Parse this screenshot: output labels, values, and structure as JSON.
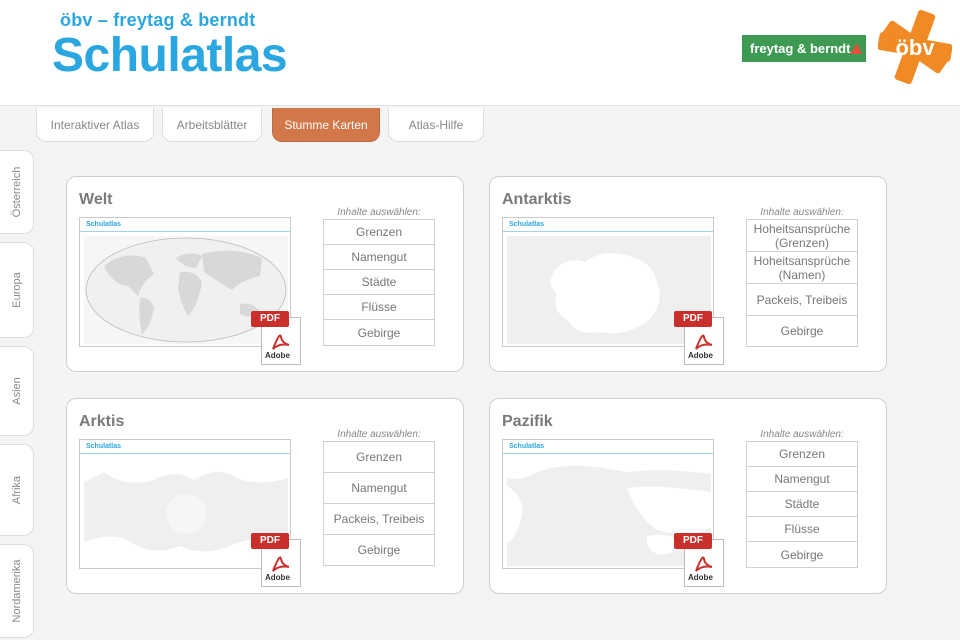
{
  "header": {
    "subtitle": "öbv – freytag & berndt",
    "title": "Schulatlas",
    "partner_logo_text": "freytag & berndt",
    "publisher_logo_text": "öbv"
  },
  "tabs": [
    {
      "label": "Interaktiver Atlas",
      "active": false
    },
    {
      "label": "Arbeitsblätter",
      "active": false
    },
    {
      "label": "Stumme Karten",
      "active": true
    },
    {
      "label": "Atlas-Hilfe",
      "active": false
    }
  ],
  "side_tabs": [
    "Österreich",
    "Europa",
    "Asien",
    "Afrika",
    "Nordamerika"
  ],
  "select_caption": "Inhalte auswählen:",
  "pdf_badge": "PDF",
  "pdf_brand": "Adobe",
  "thumb_header": "Schulatlas",
  "cards": [
    {
      "title": "Welt",
      "options": [
        "Grenzen",
        "Namengut",
        "Städte",
        "Flüsse",
        "Gebirge"
      ]
    },
    {
      "title": "Antarktis",
      "options": [
        "Hoheitsansprüche (Grenzen)",
        "Hoheitsansprüche (Namen)",
        "Packeis, Treibeis",
        "Gebirge"
      ]
    },
    {
      "title": "Arktis",
      "options": [
        "Grenzen",
        "Namengut",
        "Packeis, Treibeis",
        "Gebirge"
      ]
    },
    {
      "title": "Pazifik",
      "options": [
        "Grenzen",
        "Namengut",
        "Städte",
        "Flüsse",
        "Gebirge"
      ]
    }
  ],
  "colors": {
    "brand_blue": "#2aa7e0",
    "active_tab": "#d2774a",
    "partner_green": "#3e9a52",
    "publisher_orange": "#f08a24",
    "pdf_red": "#c9302c"
  }
}
